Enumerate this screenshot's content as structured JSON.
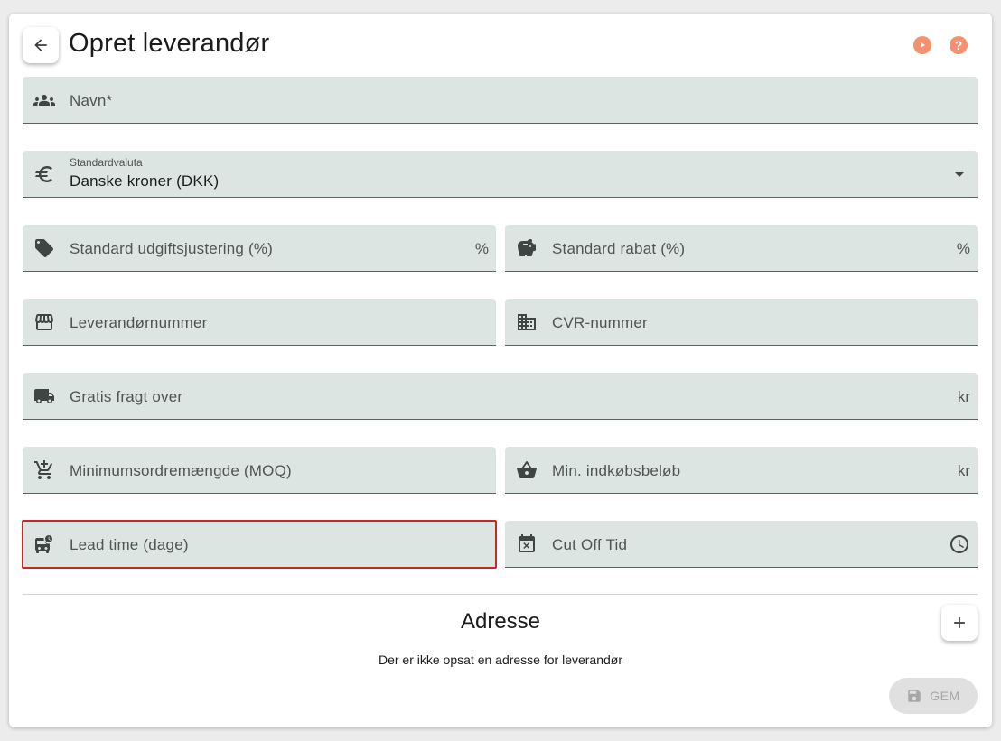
{
  "header": {
    "title": "Opret leverandør",
    "back_icon": "arrow-left-icon",
    "play_icon": "play-circle-icon",
    "help_icon": "help-circle-icon",
    "help_glyph": "?",
    "accent_color": "#f59170"
  },
  "form": {
    "name_label": "Navn*",
    "currency_label": "Standardvaluta",
    "currency_value": "Danske kroner (DKK)",
    "expense_adjust_label": "Standard udgiftsjustering (%)",
    "expense_adjust_suffix": "%",
    "discount_label": "Standard rabat (%)",
    "discount_suffix": "%",
    "supplier_number_label": "Leverandørnummer",
    "cvr_label": "CVR-nummer",
    "free_freight_label": "Gratis fragt over",
    "free_freight_suffix": "kr",
    "moq_label": "Minimumsordremængde (MOQ)",
    "min_purchase_label": "Min. indkøbsbeløb",
    "min_purchase_suffix": "kr",
    "lead_time_label": "Lead time (dage)",
    "cutoff_label": "Cut Off Tid",
    "field_bg": "#dde5e2",
    "error_color": "#c62828"
  },
  "address": {
    "title": "Adresse",
    "empty_text": "Der er ikke opsat en adresse for leverandør"
  },
  "actions": {
    "save_label": "GEM"
  }
}
